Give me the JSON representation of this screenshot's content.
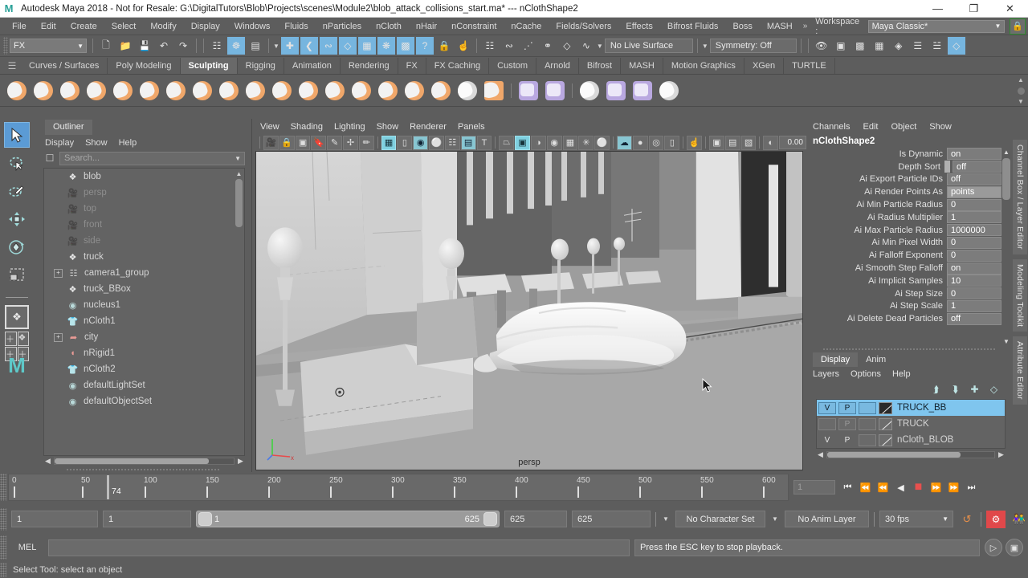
{
  "titlebar": {
    "logo": "maya-logo",
    "title": "Autodesk Maya 2018 - Not for Resale: G:\\DigitalTutors\\Blob\\Projects\\scenes\\Module2\\blob_attack_collisions_start.ma*  ---  nClothShape2",
    "minimize": "—",
    "maximize": "❐",
    "close": "✕"
  },
  "menubar": {
    "items": [
      "File",
      "Edit",
      "Create",
      "Select",
      "Modify",
      "Display",
      "Windows",
      "Fluids",
      "nParticles",
      "nCloth",
      "nHair",
      "nConstraint",
      "nCache",
      "Fields/Solvers",
      "Effects",
      "Bifrost Fluids",
      "Boss",
      "MASH"
    ],
    "overflow": "»",
    "workspace_label": "Workspace :",
    "workspace_value": "Maya Classic*",
    "lock_icon": "lock-icon"
  },
  "statusline": {
    "mode": "FX",
    "file_buttons": [
      "new-scene-icon",
      "open-scene-icon",
      "save-scene-icon",
      "undo-icon",
      "redo-icon"
    ],
    "select_modes": [
      "select-by-hierarchy-icon",
      "select-by-object-icon",
      "select-by-component-icon"
    ],
    "mask_buttons": [
      "handles-icon",
      "curves-icon",
      "surfaces-icon",
      "deformations-icon",
      "dynamics-icon",
      "rendering-icon",
      "misc-icon",
      "help-mask-icon"
    ],
    "lock_icon": "lock-selection-icon",
    "highlight_icon": "highlight-selection-icon",
    "snap_icons": [
      "snap-grid-icon",
      "snap-curve-icon",
      "snap-point-icon",
      "snap-projected-icon",
      "snap-view-plane-icon",
      "snap-uv-icon"
    ],
    "live_surface": "No Live Surface",
    "symmetry": "Symmetry: Off",
    "render_icons": [
      "render-current-frame-icon",
      "irender-icon",
      "ipr-render-icon",
      "render-settings-icon",
      "hypershade-icon",
      "outliner-editor-icon",
      "attribute-editor-icon",
      "channel-box-icon"
    ]
  },
  "shelf": {
    "tabs": [
      {
        "label": "Curves / Surfaces",
        "active": false
      },
      {
        "label": "Poly Modeling",
        "active": false
      },
      {
        "label": "Sculpting",
        "active": true
      },
      {
        "label": "Rigging",
        "active": false
      },
      {
        "label": "Animation",
        "active": false
      },
      {
        "label": "Rendering",
        "active": false
      },
      {
        "label": "FX",
        "active": false
      },
      {
        "label": "FX Caching",
        "active": false
      },
      {
        "label": "Custom",
        "active": false
      },
      {
        "label": "Arnold",
        "active": false
      },
      {
        "label": "Bifrost",
        "active": false
      },
      {
        "label": "MASH",
        "active": false
      },
      {
        "label": "Motion Graphics",
        "active": false
      },
      {
        "label": "XGen",
        "active": false
      },
      {
        "label": "TURTLE",
        "active": false
      }
    ],
    "icons": [
      {
        "name": "sculpt-tool-icon",
        "kind": "orange"
      },
      {
        "name": "smooth-tool-icon",
        "kind": "orange"
      },
      {
        "name": "relax-tool-icon",
        "kind": "orange"
      },
      {
        "name": "grab-tool-icon",
        "kind": "orange"
      },
      {
        "name": "pinch-tool-icon",
        "kind": "orange"
      },
      {
        "name": "flatten-tool-icon",
        "kind": "orange"
      },
      {
        "name": "foamy-tool-icon",
        "kind": "orange"
      },
      {
        "name": "spray-tool-icon",
        "kind": "orange"
      },
      {
        "name": "repeat-tool-icon",
        "kind": "orange"
      },
      {
        "name": "imprint-tool-icon",
        "kind": "orange"
      },
      {
        "name": "wax-tool-icon",
        "kind": "orange"
      },
      {
        "name": "scrape-tool-icon",
        "kind": "orange"
      },
      {
        "name": "fill-tool-icon",
        "kind": "orange"
      },
      {
        "name": "knife-tool-icon",
        "kind": "orange"
      },
      {
        "name": "smear-tool-icon",
        "kind": "orange"
      },
      {
        "name": "bulge-tool-icon",
        "kind": "orange"
      },
      {
        "name": "amplify-tool-icon",
        "kind": "orange"
      },
      {
        "name": "freeze-tool-icon",
        "kind": "white"
      },
      {
        "name": "sculpt-settings-icon",
        "kind": "orange-sq"
      },
      {
        "name": "mirror-mesh-icon",
        "kind": "purple"
      },
      {
        "name": "mesh-symmetry-icon",
        "kind": "purple"
      },
      {
        "name": "transfer-attributes-icon",
        "kind": "white"
      },
      {
        "name": "transfer-shading-icon",
        "kind": "purple"
      },
      {
        "name": "paint-weights-icon",
        "kind": "purple"
      },
      {
        "name": "erase-target-icon",
        "kind": "white"
      }
    ]
  },
  "toolbox": {
    "tools": [
      {
        "name": "select-tool",
        "glyph": "➤",
        "active": true
      },
      {
        "name": "lasso-select-tool",
        "glyph": "➲",
        "active": false
      },
      {
        "name": "paint-select-tool",
        "glyph": "✐",
        "active": false
      },
      {
        "name": "move-tool",
        "glyph": "✚",
        "active": false
      },
      {
        "name": "rotate-tool",
        "glyph": "⟳",
        "active": false
      },
      {
        "name": "scale-tool",
        "glyph": "◱",
        "active": false
      }
    ],
    "layout_buttons": [
      "single-perspective-layout",
      "four-view-layout",
      "persp-outliner-layout"
    ],
    "logo": "maya-m-logo"
  },
  "outliner": {
    "tab": "Outliner",
    "menu": [
      "Display",
      "Show",
      "Help"
    ],
    "search_placeholder": "Search...",
    "search_value": "",
    "items": [
      {
        "label": "blob",
        "icon": "mesh-icon",
        "indent": 1,
        "expandable": false,
        "dim": false
      },
      {
        "label": "persp",
        "icon": "camera-icon",
        "indent": 1,
        "expandable": false,
        "dim": true
      },
      {
        "label": "top",
        "icon": "camera-icon",
        "indent": 1,
        "expandable": false,
        "dim": true
      },
      {
        "label": "front",
        "icon": "camera-icon",
        "indent": 1,
        "expandable": false,
        "dim": true
      },
      {
        "label": "side",
        "icon": "camera-icon",
        "indent": 1,
        "expandable": false,
        "dim": true
      },
      {
        "label": "truck",
        "icon": "mesh-icon",
        "indent": 1,
        "expandable": false,
        "dim": false
      },
      {
        "label": "camera1_group",
        "icon": "group-icon",
        "indent": 0,
        "expandable": true,
        "dim": false
      },
      {
        "label": "truck_BBox",
        "icon": "mesh-icon",
        "indent": 1,
        "expandable": false,
        "dim": false
      },
      {
        "label": "nucleus1",
        "icon": "nucleus-icon",
        "indent": 1,
        "expandable": false,
        "dim": false
      },
      {
        "label": "nCloth1",
        "icon": "ncloth-icon",
        "indent": 1,
        "expandable": false,
        "dim": false
      },
      {
        "label": "city",
        "icon": "city-icon",
        "indent": 0,
        "expandable": true,
        "dim": false
      },
      {
        "label": "nRigid1",
        "icon": "nrigid-icon",
        "indent": 1,
        "expandable": false,
        "dim": false
      },
      {
        "label": "nCloth2",
        "icon": "ncloth-icon",
        "indent": 1,
        "expandable": false,
        "dim": false
      },
      {
        "label": "defaultLightSet",
        "icon": "set-icon",
        "indent": 1,
        "expandable": false,
        "dim": false
      },
      {
        "label": "defaultObjectSet",
        "icon": "set-icon",
        "indent": 1,
        "expandable": false,
        "dim": false
      }
    ]
  },
  "viewport": {
    "menu": [
      "View",
      "Shading",
      "Lighting",
      "Show",
      "Renderer",
      "Panels"
    ],
    "camera_label": "persp",
    "exposure_value": "0.00",
    "toolbar_icons": [
      {
        "name": "select-camera-icon",
        "state": "off"
      },
      {
        "name": "lock-camera-icon",
        "state": "off"
      },
      {
        "name": "camera-attributes-icon",
        "state": "off"
      },
      {
        "name": "bookmark-icon",
        "state": "off"
      },
      {
        "name": "image-plane-icon",
        "state": "off"
      },
      {
        "name": "two-d-pan-zoom-icon",
        "state": "off"
      },
      {
        "name": "grease-pencil-icon",
        "state": "off"
      },
      {
        "name": "grid-icon",
        "state": "on"
      },
      {
        "name": "film-gate-icon",
        "state": "off"
      },
      {
        "name": "resolution-gate-icon",
        "state": "off"
      },
      {
        "name": "gate-mask-icon",
        "state": "off"
      },
      {
        "name": "field-chart-icon",
        "state": "off"
      },
      {
        "name": "safe-action-icon",
        "state": "off"
      },
      {
        "name": "safe-title-icon",
        "state": "off"
      },
      {
        "name": "wireframe-icon",
        "state": "off"
      },
      {
        "name": "smooth-shade-all-icon",
        "state": "on"
      },
      {
        "name": "smooth-shade-selected-icon",
        "state": "off"
      },
      {
        "name": "flat-shade-icon",
        "state": "off"
      },
      {
        "name": "shaded-wireframe-icon",
        "state": "off"
      },
      {
        "name": "use-default-material-icon",
        "state": "off"
      },
      {
        "name": "shade-options-icon",
        "state": "off"
      },
      {
        "name": "texture-icon",
        "state": "on"
      },
      {
        "name": "use-all-lights-icon",
        "state": "off"
      },
      {
        "name": "shadows-icon",
        "state": "off"
      },
      {
        "name": "screen-space-ao-icon",
        "state": "off"
      },
      {
        "name": "motion-blur-icon",
        "state": "off"
      },
      {
        "name": "isolate-select-icon",
        "state": "off"
      },
      {
        "name": "xray-icon",
        "state": "off"
      },
      {
        "name": "xray-joints-icon",
        "state": "off"
      },
      {
        "name": "xray-active-components-icon",
        "state": "off"
      },
      {
        "name": "exposure-icon",
        "state": "off"
      }
    ]
  },
  "channelbox": {
    "menu": [
      "Channels",
      "Edit",
      "Object",
      "Show"
    ],
    "node_name": "nClothShape2",
    "attributes": [
      {
        "name": "Is Dynamic",
        "value": "on"
      },
      {
        "name": "Depth Sort",
        "value": "off"
      },
      {
        "name": "Ai Export Particle IDs",
        "value": "off"
      },
      {
        "name": "Ai Render Points As",
        "value": "points"
      },
      {
        "name": "Ai Min Particle Radius",
        "value": "0"
      },
      {
        "name": "Ai Radius Multiplier",
        "value": "1"
      },
      {
        "name": "Ai Max Particle Radius",
        "value": "1000000"
      },
      {
        "name": "Ai Min Pixel Width",
        "value": "0"
      },
      {
        "name": "Ai Falloff Exponent",
        "value": "0"
      },
      {
        "name": "Ai Smooth Step Falloff",
        "value": "on"
      },
      {
        "name": "Ai Implicit Samples",
        "value": "10"
      },
      {
        "name": "Ai Step Size",
        "value": "0"
      },
      {
        "name": "Ai Step Scale",
        "value": "1"
      },
      {
        "name": "Ai Delete Dead Particles",
        "value": "off"
      }
    ]
  },
  "layereditor": {
    "tabs": [
      {
        "label": "Display",
        "active": true
      },
      {
        "label": "Anim",
        "active": false
      }
    ],
    "menu": [
      "Layers",
      "Options",
      "Help"
    ],
    "buttons": [
      "move-layer-up-icon",
      "move-layer-down-icon",
      "new-layer-icon",
      "new-layer-from-selected-icon"
    ],
    "layers": [
      {
        "name": "TRUCK_BB",
        "v": "V",
        "p": "P",
        "third": "",
        "selected": true,
        "swatch": "line"
      },
      {
        "name": "TRUCK",
        "v": "",
        "p": "P",
        "third": "",
        "selected": false,
        "swatch": "line"
      },
      {
        "name": "nCloth_BLOB",
        "v": "V",
        "p": "P",
        "third": "",
        "selected": false,
        "swatch": "line"
      }
    ]
  },
  "rightpanel": {
    "vertical_tabs": [
      "Channel Box / Layer Editor",
      "Modeling Toolkit",
      "Attribute Editor"
    ]
  },
  "timeslider": {
    "ticks": [
      "0",
      "50",
      "100",
      "150",
      "200",
      "250",
      "300",
      "350",
      "400",
      "450",
      "500",
      "550",
      "600"
    ],
    "current_frame": "74",
    "frame_field": "1",
    "playback_buttons": [
      {
        "name": "go-to-start-button",
        "glyph": "⏮"
      },
      {
        "name": "step-back-frame-button",
        "glyph": "⏴|"
      },
      {
        "name": "step-back-key-button",
        "glyph": "|◀"
      },
      {
        "name": "play-backwards-button",
        "glyph": "◀"
      },
      {
        "name": "stop-playback-button",
        "glyph": "■"
      },
      {
        "name": "play-forwards-button",
        "glyph": "▶|"
      },
      {
        "name": "step-forward-key-button",
        "glyph": "▶|"
      },
      {
        "name": "go-to-end-button",
        "glyph": "⏭"
      }
    ]
  },
  "rangeslider": {
    "anim_start": "1",
    "range_start": "1",
    "bar_start": "1",
    "bar_end": "625",
    "range_end": "625",
    "anim_end": "625",
    "character_set": "No Character Set",
    "anim_layer": "No Anim Layer",
    "fps": "30 fps",
    "auto_key_icon": "auto-keyframe-icon",
    "anim_prefs_icon": "animation-preferences-icon",
    "char_icon": "character-icon"
  },
  "commandline": {
    "language": "MEL",
    "input_value": "",
    "message": "Press the ESC key to stop playback.",
    "script_editor_icon": "script-editor-icon",
    "playblast_icon": "playblast-icon"
  },
  "helpline": {
    "text": "Select Tool: select an object"
  },
  "colors": {
    "window_bg": "#5d5d5d",
    "accent_blue": "#5b9bd5",
    "layer_selected": "#7fc5ee",
    "stop_red": "#e8504e",
    "sculpt_orange": "#f0a76a",
    "teal_icon": "#9fdada"
  }
}
